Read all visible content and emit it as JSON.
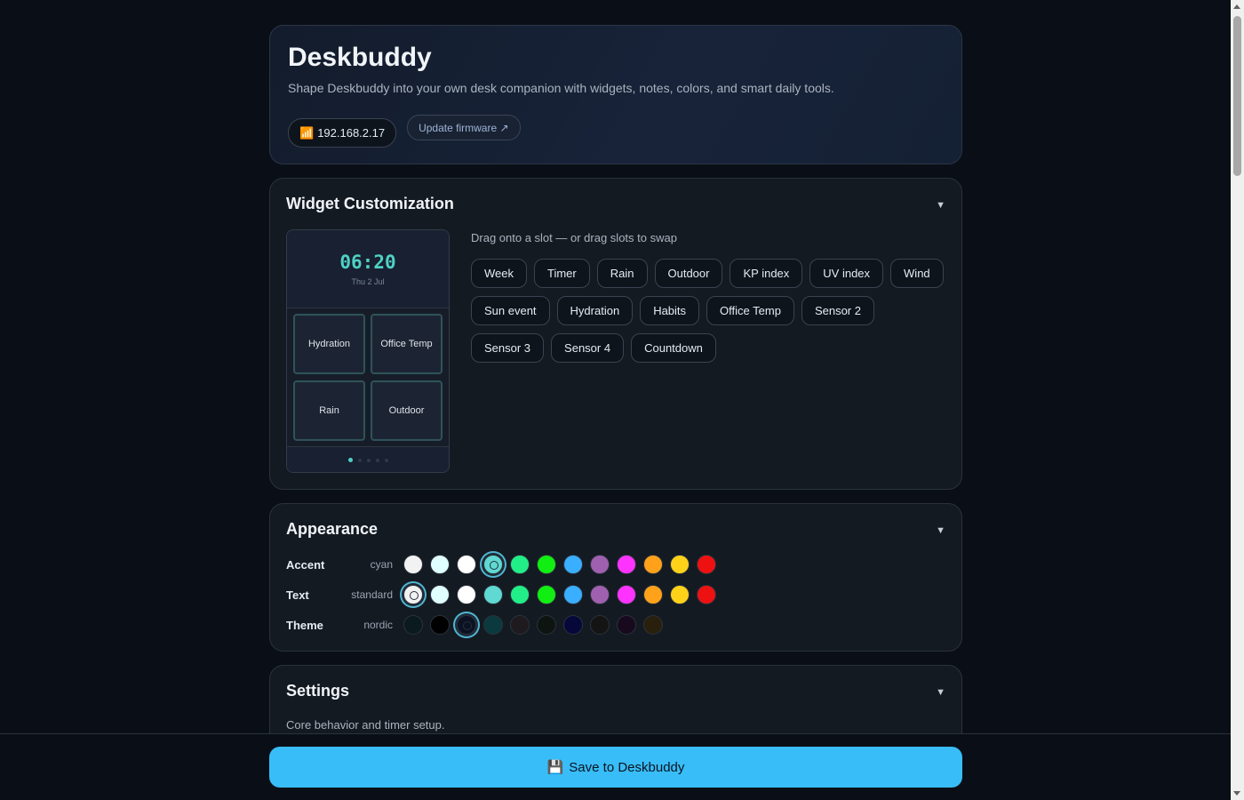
{
  "header": {
    "title": "Deskbuddy",
    "subtitle": "Shape Deskbuddy into your own desk companion with widgets, notes, colors, and smart daily tools.",
    "ip": "192.168.2.17",
    "wifi_icon": "wifi-icon",
    "firmware_label": "Update firmware ↗"
  },
  "widget": {
    "title": "Widget Customization",
    "device": {
      "time": "06:20",
      "date": "Thu 2 Jul",
      "slots": [
        "Hydration",
        "Office Temp",
        "Rain",
        "Outdoor"
      ],
      "pages": 5,
      "active_page": 1
    },
    "hint": "Drag onto a slot — or drag slots to swap",
    "chips": [
      "Week",
      "Timer",
      "Rain",
      "Outdoor",
      "KP index",
      "UV index",
      "Wind",
      "Sun event",
      "Hydration",
      "Habits",
      "Office Temp",
      "Sensor 2",
      "Sensor 3",
      "Sensor 4",
      "Countdown"
    ]
  },
  "appearance": {
    "title": "Appearance",
    "rows": [
      {
        "label": "Accent",
        "value": "cyan",
        "selected": 3,
        "colors": [
          "#f2f2f2",
          "#e0ffff",
          "#ffffff",
          "#5fd9d2",
          "#22ee88",
          "#11ee11",
          "#3aaeff",
          "#a060b0",
          "#ff33ff",
          "#ffa21a",
          "#ffd21a",
          "#ee1111"
        ]
      },
      {
        "label": "Text",
        "value": "standard",
        "selected": 0,
        "colors": [
          "#f2f2f2",
          "#e0ffff",
          "#ffffff",
          "#5fd9d2",
          "#22ee88",
          "#11ee11",
          "#3aaeff",
          "#a060b0",
          "#ff33ff",
          "#ffa21a",
          "#ffd21a",
          "#ee1111"
        ]
      },
      {
        "label": "Theme",
        "value": "nordic",
        "selected": 2,
        "colors": [
          "#0a1a1e",
          "#000000",
          "#0c1224",
          "#0a3a3e",
          "#1e1a1e",
          "#0e1410",
          "#06083a",
          "#141414",
          "#180a1e",
          "#28200c"
        ]
      }
    ]
  },
  "settings": {
    "title": "Settings",
    "subtitle": "Core behavior and timer setup."
  },
  "footer": {
    "save_label": "Save to Deskbuddy",
    "save_icon": "💾"
  }
}
